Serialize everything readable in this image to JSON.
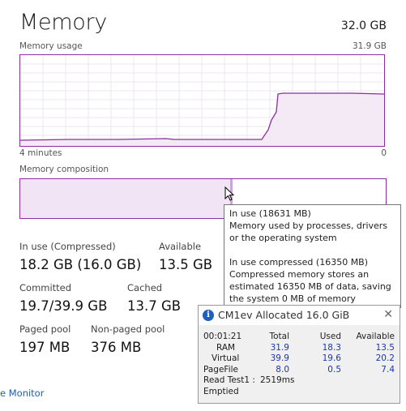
{
  "header": {
    "title": "Memory",
    "total": "32.0 GB"
  },
  "usage_graph": {
    "label": "Memory usage",
    "max_label": "31.9 GB",
    "time_label": "4 minutes",
    "end_label": "0",
    "line_color": "#8b2fa0",
    "fill_color": "#f3eaf5"
  },
  "composition": {
    "label": "Memory composition"
  },
  "stats": {
    "in_use": {
      "label": "In use (Compressed)",
      "value": "18.2 GB (16.0 GB)"
    },
    "available": {
      "label": "Available",
      "value": "13.5 GB"
    },
    "committed": {
      "label": "Committed",
      "value": "19.7/39.9 GB"
    },
    "cached": {
      "label": "Cached",
      "value": "13.7 GB"
    },
    "paged_pool": {
      "label": "Paged pool",
      "value": "197 MB"
    },
    "nonpaged_pool": {
      "label": "Non-paged pool",
      "value": "376 MB"
    }
  },
  "footer": {
    "link": "e Monitor"
  },
  "tooltip": {
    "line1": "In use (18631 MB)",
    "line2": "Memory used by processes, drivers or the operating system",
    "line3": "In use compressed (16350 MB)",
    "line4": "Compressed memory stores an estimated 16350 MB of data, saving the system 0 MB of memory"
  },
  "dialog": {
    "title": "CM1ev Allocated 16.0 GiB",
    "timer": "00:01:21",
    "headers": [
      "Total",
      "Used",
      "Available"
    ],
    "rows": [
      {
        "label": "RAM",
        "total": "31.9",
        "used": "18.3",
        "available": "13.5"
      },
      {
        "label": "Virtual",
        "total": "39.9",
        "used": "19.6",
        "available": "20.2"
      },
      {
        "label": "PageFile",
        "total": "8.0",
        "used": "0.5",
        "available": "7.4"
      }
    ],
    "read_label": "Read Test1 :",
    "read_value": "2519ms",
    "status": "Emptied"
  }
}
